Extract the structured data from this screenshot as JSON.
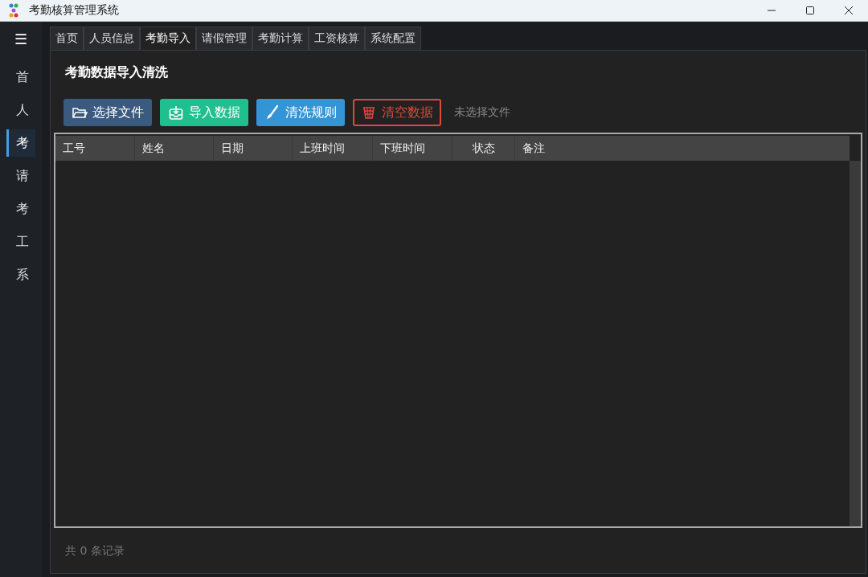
{
  "window": {
    "title": "考勤核算管理系统"
  },
  "sidebar": {
    "menu_icon": "☰",
    "items": [
      {
        "label": "首",
        "selected": false
      },
      {
        "label": "人",
        "selected": false
      },
      {
        "label": "考",
        "selected": true
      },
      {
        "label": "请",
        "selected": false
      },
      {
        "label": "考",
        "selected": false
      },
      {
        "label": "工",
        "selected": false
      },
      {
        "label": "系",
        "selected": false
      }
    ]
  },
  "tabs": [
    {
      "label": "首页",
      "selected": false
    },
    {
      "label": "人员信息",
      "selected": false
    },
    {
      "label": "考勤导入",
      "selected": true
    },
    {
      "label": "请假管理",
      "selected": false
    },
    {
      "label": "考勤计算",
      "selected": false
    },
    {
      "label": "工资核算",
      "selected": false
    },
    {
      "label": "系统配置",
      "selected": false
    }
  ],
  "page_title": "考勤数据导入清洗",
  "buttons": [
    {
      "label": "选择文件",
      "kind": "folder"
    },
    {
      "label": "导入数据",
      "kind": "import"
    },
    {
      "label": "清洗规则",
      "kind": "brush"
    },
    {
      "label": "清空数据",
      "kind": "clear"
    }
  ],
  "file_status": "未选择文件",
  "table": {
    "columns": [
      "工号",
      "姓名",
      "日期",
      "上班时间",
      "下班时间",
      "状态",
      "备注"
    ]
  },
  "status_bar": "共 0 条记录"
}
